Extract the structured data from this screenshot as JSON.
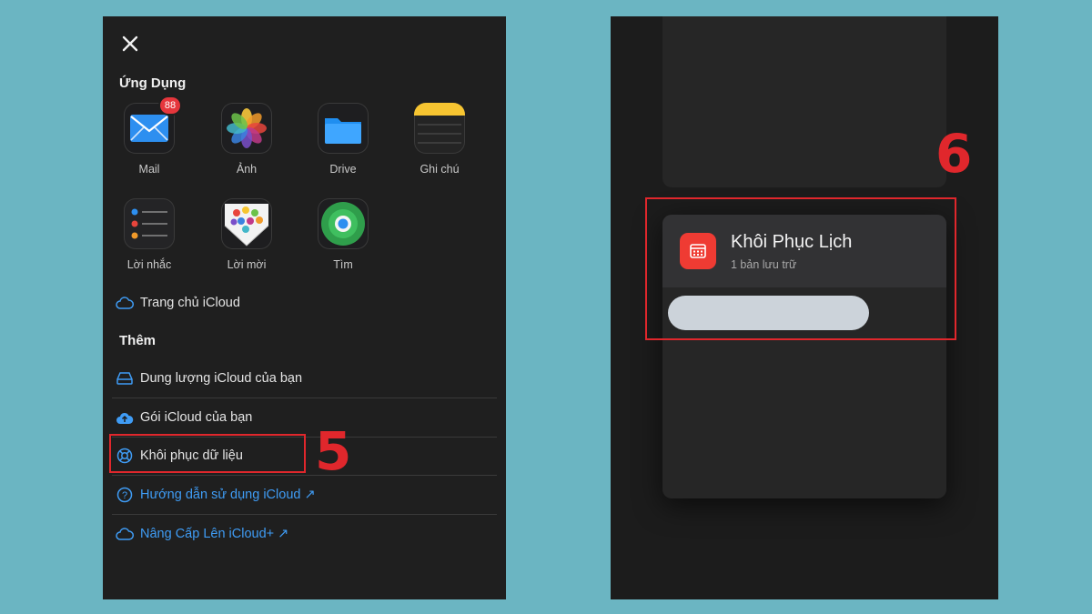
{
  "left": {
    "apps_title": "Ứng Dụng",
    "apps": [
      {
        "name": "mail",
        "label": "Mail",
        "badge": "88"
      },
      {
        "name": "photos",
        "label": "Ảnh"
      },
      {
        "name": "drive",
        "label": "Drive"
      },
      {
        "name": "notes",
        "label": "Ghi chú"
      },
      {
        "name": "reminders",
        "label": "Lời nhắc"
      },
      {
        "name": "invites",
        "label": "Lời mời"
      },
      {
        "name": "find",
        "label": "Tìm"
      }
    ],
    "home_link": "Trang chủ iCloud",
    "more_title": "Thêm",
    "more_items": [
      {
        "label": "Dung lượng iCloud của bạn"
      },
      {
        "label": "Gói iCloud của bạn"
      },
      {
        "label": "Khôi phục dữ liệu"
      },
      {
        "label": "Hướng dẫn sử dụng iCloud ↗"
      },
      {
        "label": "Nâng Cấp Lên iCloud+ ↗"
      }
    ],
    "step": "5"
  },
  "right": {
    "card_title": "Khôi Phục Lịch",
    "card_subtitle": "1 bản lưu trữ",
    "step": "6"
  },
  "colors": {
    "background": "#6bb5c2",
    "panel": "#1f1f1f",
    "link": "#3f9cf5",
    "highlight": "#e0272c"
  }
}
